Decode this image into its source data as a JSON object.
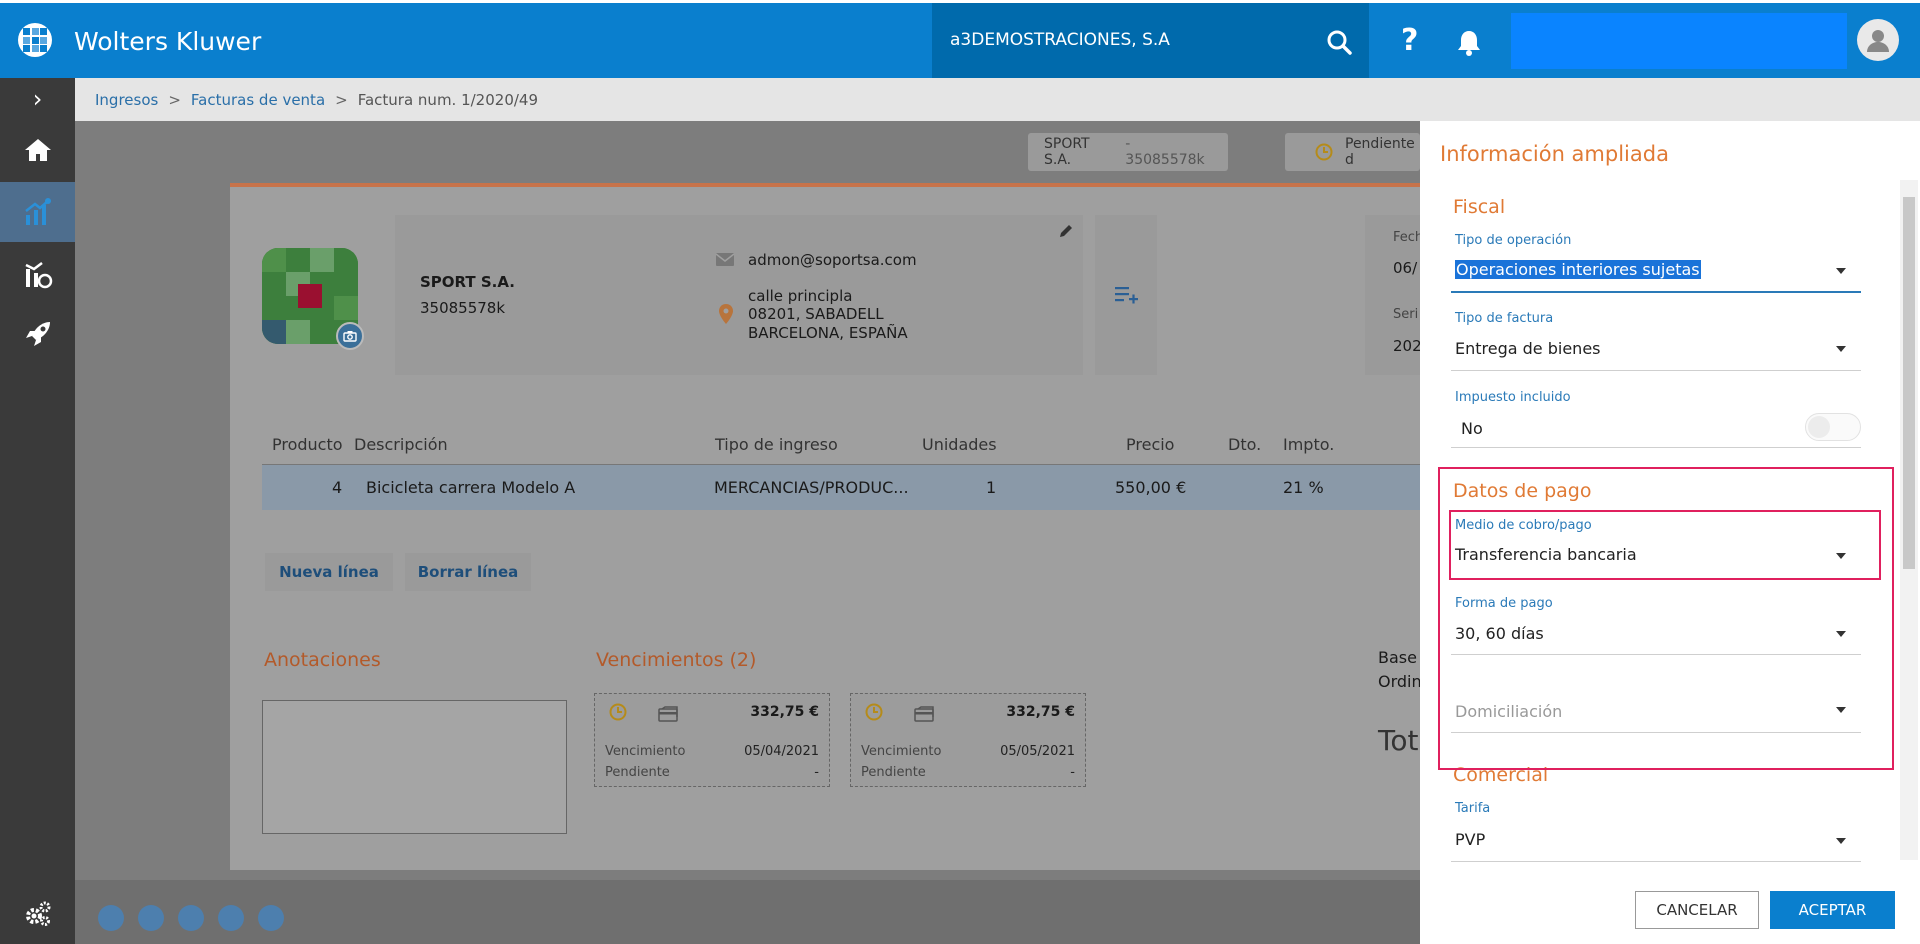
{
  "header": {
    "brand": "Wolters Kluwer",
    "company": "a3DEMOSTRACIONES, S.A",
    "help_glyph": "?"
  },
  "sidebar": {
    "toggle_glyph": "›",
    "items": [
      {
        "icon": "home-icon"
      },
      {
        "icon": "sales-chart-icon",
        "active": true
      },
      {
        "icon": "analytics-icon"
      },
      {
        "icon": "rocket-icon"
      }
    ],
    "settings_icon": "gears-icon"
  },
  "breadcrumb": {
    "item1": "Ingresos",
    "item2": "Facturas de venta",
    "current": "Factura num. 1/2020/49",
    "sep": ">"
  },
  "pills": {
    "customer": "SPORT S.A.",
    "customer_id": "- 35085578k",
    "status": "Pendiente d"
  },
  "customer": {
    "name": "SPORT S.A.",
    "nif": "35085578k",
    "email": "admon@soportsa.com",
    "address1": "calle principla",
    "address2": "08201, SABADELL",
    "address3": "BARCELONA, ESPAÑA"
  },
  "invoice_side": {
    "date_label": "Fech",
    "date_value": "06/",
    "serie_label": "Seri",
    "serie_value": "202"
  },
  "table": {
    "headers": [
      "Producto",
      "Descripción",
      "Tipo de ingreso",
      "Unidades",
      "Precio",
      "Dto.",
      "Impto."
    ],
    "row": {
      "producto": "4",
      "descripcion": "Bicicleta carrera Modelo A",
      "tipo": "MERCANCIAS/PRODUC...",
      "unidades": "1",
      "precio": "550,00 €",
      "dto": "",
      "impto": "21 %"
    }
  },
  "buttons": {
    "nueva_linea": "Nueva línea",
    "borrar_linea": "Borrar línea",
    "cancelar": "CANCELAR",
    "aceptar": "ACEPTAR"
  },
  "anotaciones": {
    "title": "Anotaciones"
  },
  "vencimientos": {
    "title": "Vencimientos (2)",
    "items": [
      {
        "amount": "332,75 €",
        "venc_label": "Vencimiento",
        "venc_date": "05/04/2021",
        "pend_label": "Pendiente",
        "pend_value": "-"
      },
      {
        "amount": "332,75 €",
        "venc_label": "Vencimiento",
        "venc_date": "05/05/2021",
        "pend_label": "Pendiente",
        "pend_value": "-"
      }
    ]
  },
  "totals": {
    "base_label": "Base",
    "ordin_label": "Ordin",
    "total_label": "Tot"
  },
  "panel": {
    "title": "Información ampliada",
    "fiscal": {
      "title": "Fiscal",
      "tipo_operacion_label": "Tipo de operación",
      "tipo_operacion_value": "Operaciones interiores sujetas",
      "tipo_factura_label": "Tipo de factura",
      "tipo_factura_value": "Entrega de bienes",
      "impuesto_label": "Impuesto incluido",
      "impuesto_value": "No"
    },
    "pago": {
      "title": "Datos de pago",
      "medio_label": "Medio de cobro/pago",
      "medio_value": "Transferencia bancaria",
      "forma_label": "Forma de pago",
      "forma_value": "30, 60 días",
      "domiciliacion_placeholder": "Domiciliación"
    },
    "comercial": {
      "title": "Comercial",
      "tarifa_label": "Tarifa",
      "tarifa_value": "PVP"
    }
  },
  "colors": {
    "brand_blue": "#0a7fce",
    "accent_orange": "#e07a35",
    "highlight_red": "#e0205e"
  }
}
